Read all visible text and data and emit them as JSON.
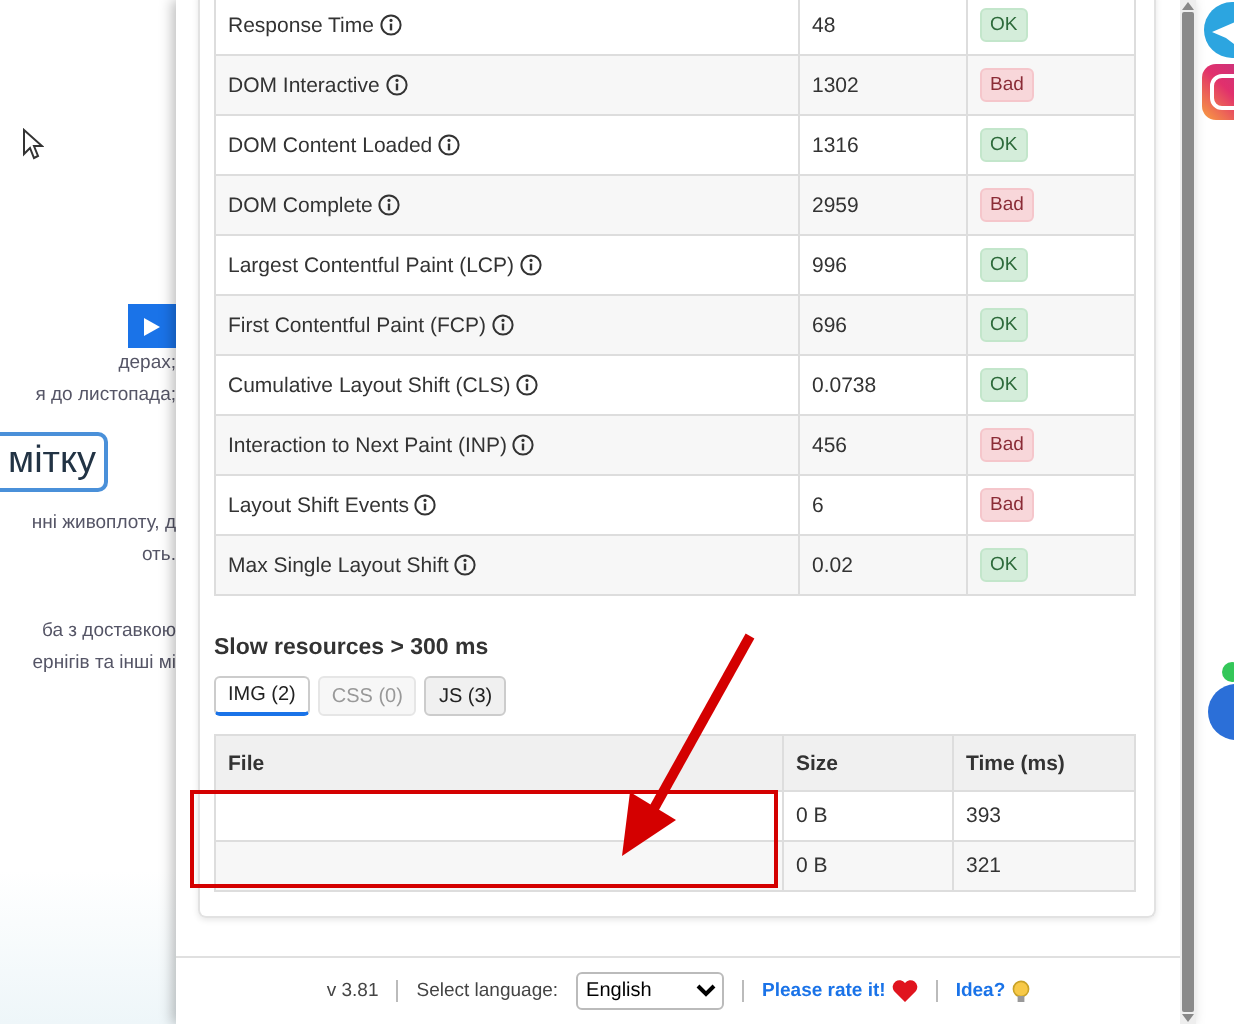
{
  "background_page": {
    "lines_top": [
      "дерах;",
      "я до листопада;"
    ],
    "button": "мітку",
    "lines_middle": [
      "нні живоплоту, д",
      "оть."
    ],
    "lines_bottom": [
      "ба з доставкою",
      "ернігів та інші мі"
    ]
  },
  "metrics": [
    {
      "name": "Response Time",
      "value": "48",
      "status": "OK",
      "kind": "good"
    },
    {
      "name": "DOM Interactive",
      "value": "1302",
      "status": "Bad",
      "kind": "bad"
    },
    {
      "name": "DOM Content Loaded",
      "value": "1316",
      "status": "OK",
      "kind": "good"
    },
    {
      "name": "DOM Complete",
      "value": "2959",
      "status": "Bad",
      "kind": "bad"
    },
    {
      "name": "Largest Contentful Paint (LCP)",
      "value": "996",
      "status": "OK",
      "kind": "good"
    },
    {
      "name": "First Contentful Paint (FCP)",
      "value": "696",
      "status": "OK",
      "kind": "good"
    },
    {
      "name": "Cumulative Layout Shift (CLS)",
      "value": "0.0738",
      "status": "OK",
      "kind": "good"
    },
    {
      "name": "Interaction to Next Paint (INP)",
      "value": "456",
      "status": "Bad",
      "kind": "bad"
    },
    {
      "name": "Layout Shift Events",
      "value": "6",
      "status": "Bad",
      "kind": "bad"
    },
    {
      "name": "Max Single Layout Shift",
      "value": "0.02",
      "status": "OK",
      "kind": "good"
    }
  ],
  "slow_resources": {
    "title": "Slow resources > 300 ms",
    "tabs": [
      {
        "label": "IMG (2)",
        "selected": true,
        "disabled": false
      },
      {
        "label": "CSS (0)",
        "selected": false,
        "disabled": true
      },
      {
        "label": "JS (3)",
        "selected": false,
        "disabled": false
      }
    ],
    "columns": [
      "File",
      "Size",
      "Time (ms)"
    ],
    "rows": [
      {
        "size": "0 B",
        "time": "393"
      },
      {
        "size": "0 B",
        "time": "321"
      }
    ]
  },
  "footer": {
    "version": "v 3.81",
    "language_label": "Select language:",
    "language": "English",
    "rate_link": "Please rate it!",
    "idea_link": "Idea?"
  }
}
